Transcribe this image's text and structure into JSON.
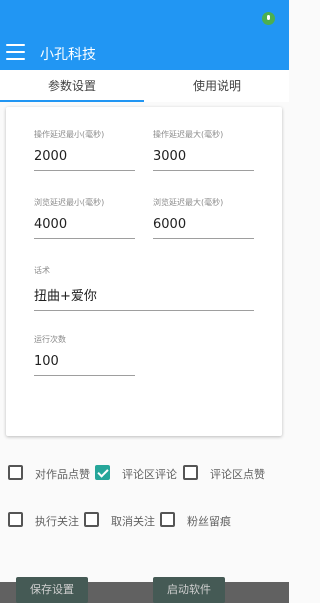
{
  "app": {
    "title": "小孔科技"
  },
  "tabs": [
    {
      "label": "参数设置"
    },
    {
      "label": "使用说明"
    }
  ],
  "fields": {
    "op_delay_min": {
      "label": "操作延迟最小(毫秒)",
      "value": "2000"
    },
    "op_delay_max": {
      "label": "操作延迟最大(毫秒)",
      "value": "3000"
    },
    "browse_delay_min": {
      "label": "浏览延迟最小(毫秒)",
      "value": "4000"
    },
    "browse_delay_max": {
      "label": "浏览延迟最大(毫秒)",
      "value": "6000"
    },
    "speech": {
      "label": "话术",
      "value": "扭曲+爱你"
    },
    "run_count": {
      "label": "运行次数",
      "value": "100"
    }
  },
  "checkboxes": [
    {
      "label": "对作品点赞",
      "checked": false
    },
    {
      "label": "评论区评论",
      "checked": true
    },
    {
      "label": "评论区点赞",
      "checked": false
    },
    {
      "label": "执行关注",
      "checked": false
    },
    {
      "label": "取消关注",
      "checked": false
    },
    {
      "label": "粉丝留痕",
      "checked": false
    }
  ],
  "buttons": {
    "save": "保存设置",
    "start": "启动软件"
  },
  "colors": {
    "primary": "#2196f3",
    "accent": "#26a69a"
  },
  "icons": {
    "status": "mic-icon",
    "menu": "menu-icon"
  }
}
